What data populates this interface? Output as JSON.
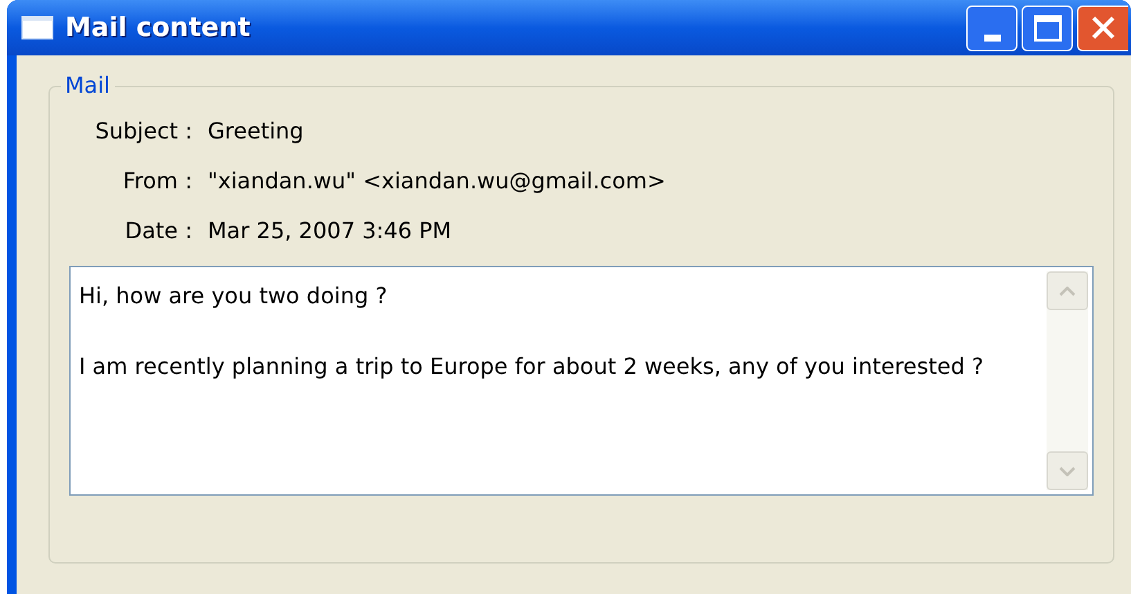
{
  "window": {
    "title": "Mail content"
  },
  "group": {
    "label": "Mail"
  },
  "fields": [
    {
      "label": "Subject :",
      "value": "Greeting"
    },
    {
      "label": "From :",
      "value": "\"xiandan.wu\" <xiandan.wu@gmail.com>"
    },
    {
      "label": "Date :",
      "value": "Mar 25, 2007 3:46 PM"
    }
  ],
  "body": {
    "paragraphs": [
      "Hi, how are you two doing ?",
      "I am recently planning a trip to Europe for about 2 weeks, any of you interested ?"
    ]
  }
}
